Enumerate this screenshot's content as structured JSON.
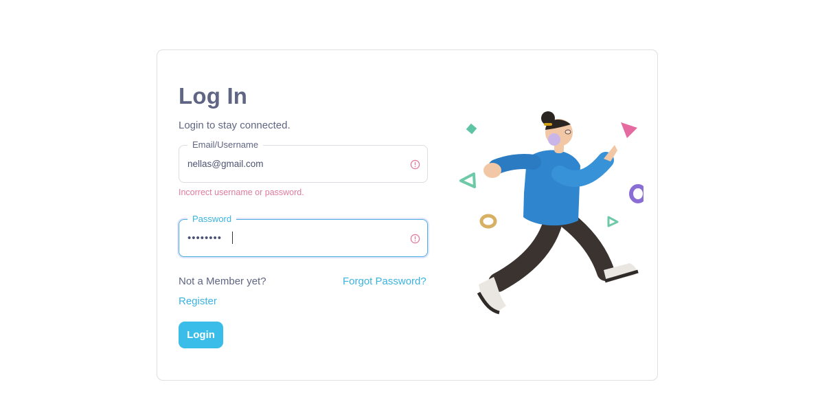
{
  "heading": {
    "title": "Log In",
    "subtitle": "Login to stay connected."
  },
  "email": {
    "label": "Email/Username",
    "value": "nellas@gmail.com",
    "error": "Incorrect username or password."
  },
  "password": {
    "label": "Password",
    "value": "••••••••"
  },
  "links": {
    "not_member": "Not a Member yet?",
    "forgot": "Forgot Password?",
    "register": "Register"
  },
  "actions": {
    "login": "Login"
  },
  "colors": {
    "accent": "#3abde8",
    "error": "#e07a9e",
    "text": "#5f6582"
  },
  "icons": {
    "field_status": "alert-circle-icon",
    "illustration": "running-person-illustration"
  }
}
